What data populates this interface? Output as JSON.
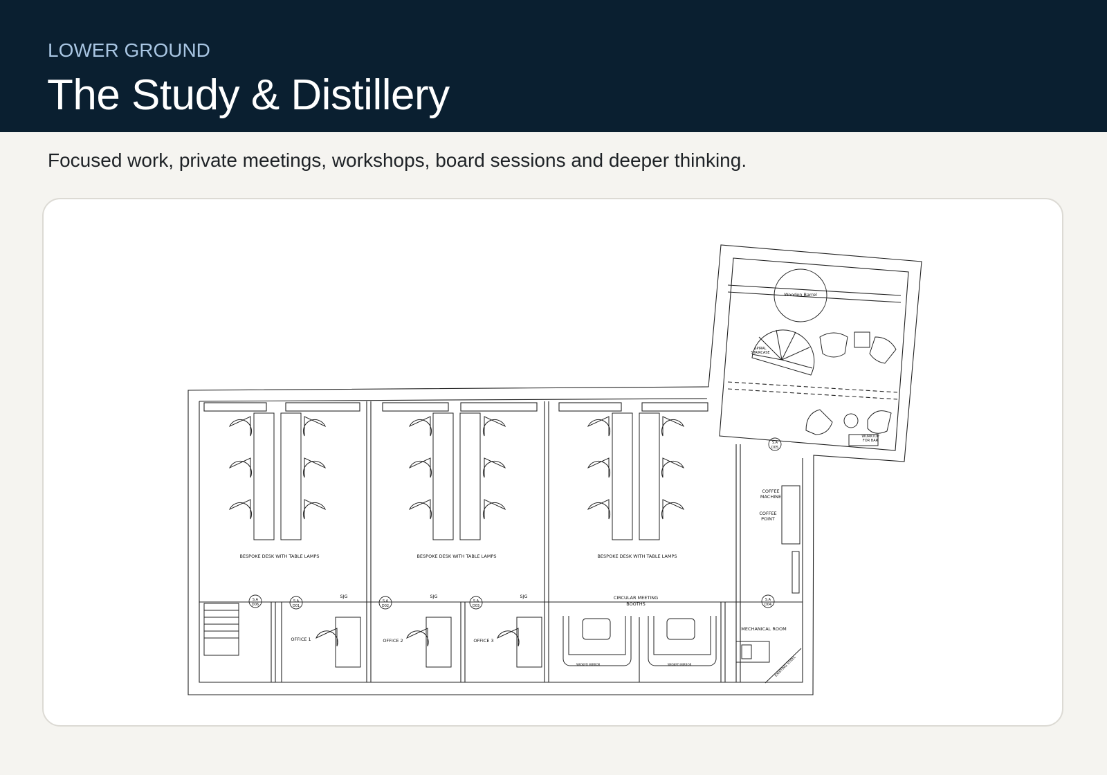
{
  "header": {
    "eyebrow": "LOWER GROUND",
    "title": "The Study & Distillery",
    "subtitle": "Focused work, private meetings, workshops, board sessions and deeper thinking."
  },
  "colors": {
    "header_bg": "#0a1f30",
    "eyebrow": "#a9c6e3",
    "page_bg": "#f5f4f0",
    "card_bg": "#ffffff",
    "line": "#222222"
  },
  "plan": {
    "desk_label": "BESPOKE DESK WITH TABLE LAMPS",
    "circular_booths": "CIRCULAR MEETING",
    "circular_booths_2": "BOOTHS",
    "office_1": "OFFICE 1",
    "office_2": "OFFICE 2",
    "office_3": "OFFICE 3",
    "sjg": "SJG",
    "wooden_barrel": "Wooden Barrel",
    "spiral": "SPIRAL",
    "staircase": "STAIRCASE",
    "coffee_machine_1": "COFFEE",
    "coffee_machine_2": "MACHINE",
    "coffee_point_1": "COFFEE",
    "coffee_point_2": "POINT",
    "mechanical_room": "MECHANICAL ROOM",
    "worktop_1": "WORKTOP",
    "worktop_2": "FOR BAR",
    "smoked_mirror": "SMOKED MIRROR",
    "existing_steel": "EXISTING STEEL",
    "tag_sa": "S.A",
    "tag_d05": "D05",
    "tag_d01": "D01",
    "tag_d02": "D02",
    "tag_d03": "D03",
    "tag_d04": "D04",
    "tag_d06": "D06"
  }
}
